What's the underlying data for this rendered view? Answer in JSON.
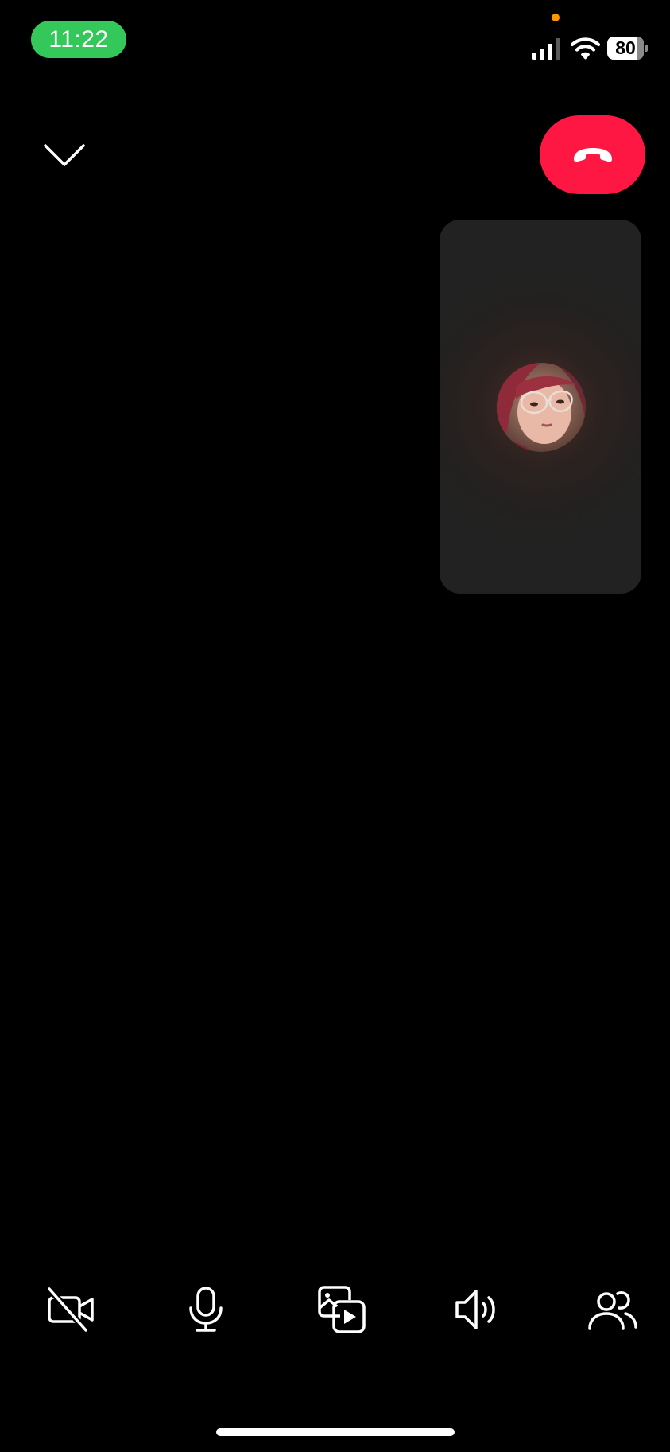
{
  "status_bar": {
    "time": "11:22",
    "battery_level": "80",
    "battery_fraction": 0.8,
    "signal_bars_active": 3,
    "time_pill_color": "#34c759",
    "privacy_dot_color": "#ff9500"
  },
  "header": {
    "minimize_icon": "chevron-down-icon",
    "end_call_icon": "phone-hangup-icon",
    "end_call_color": "#ff1744"
  },
  "self_view": {
    "avatar_icon": "user-avatar"
  },
  "controls": [
    {
      "name": "camera-off",
      "icon": "video-off-icon"
    },
    {
      "name": "microphone",
      "icon": "microphone-icon"
    },
    {
      "name": "share-media",
      "icon": "media-share-icon"
    },
    {
      "name": "speaker",
      "icon": "speaker-icon"
    },
    {
      "name": "participants",
      "icon": "people-icon"
    }
  ]
}
